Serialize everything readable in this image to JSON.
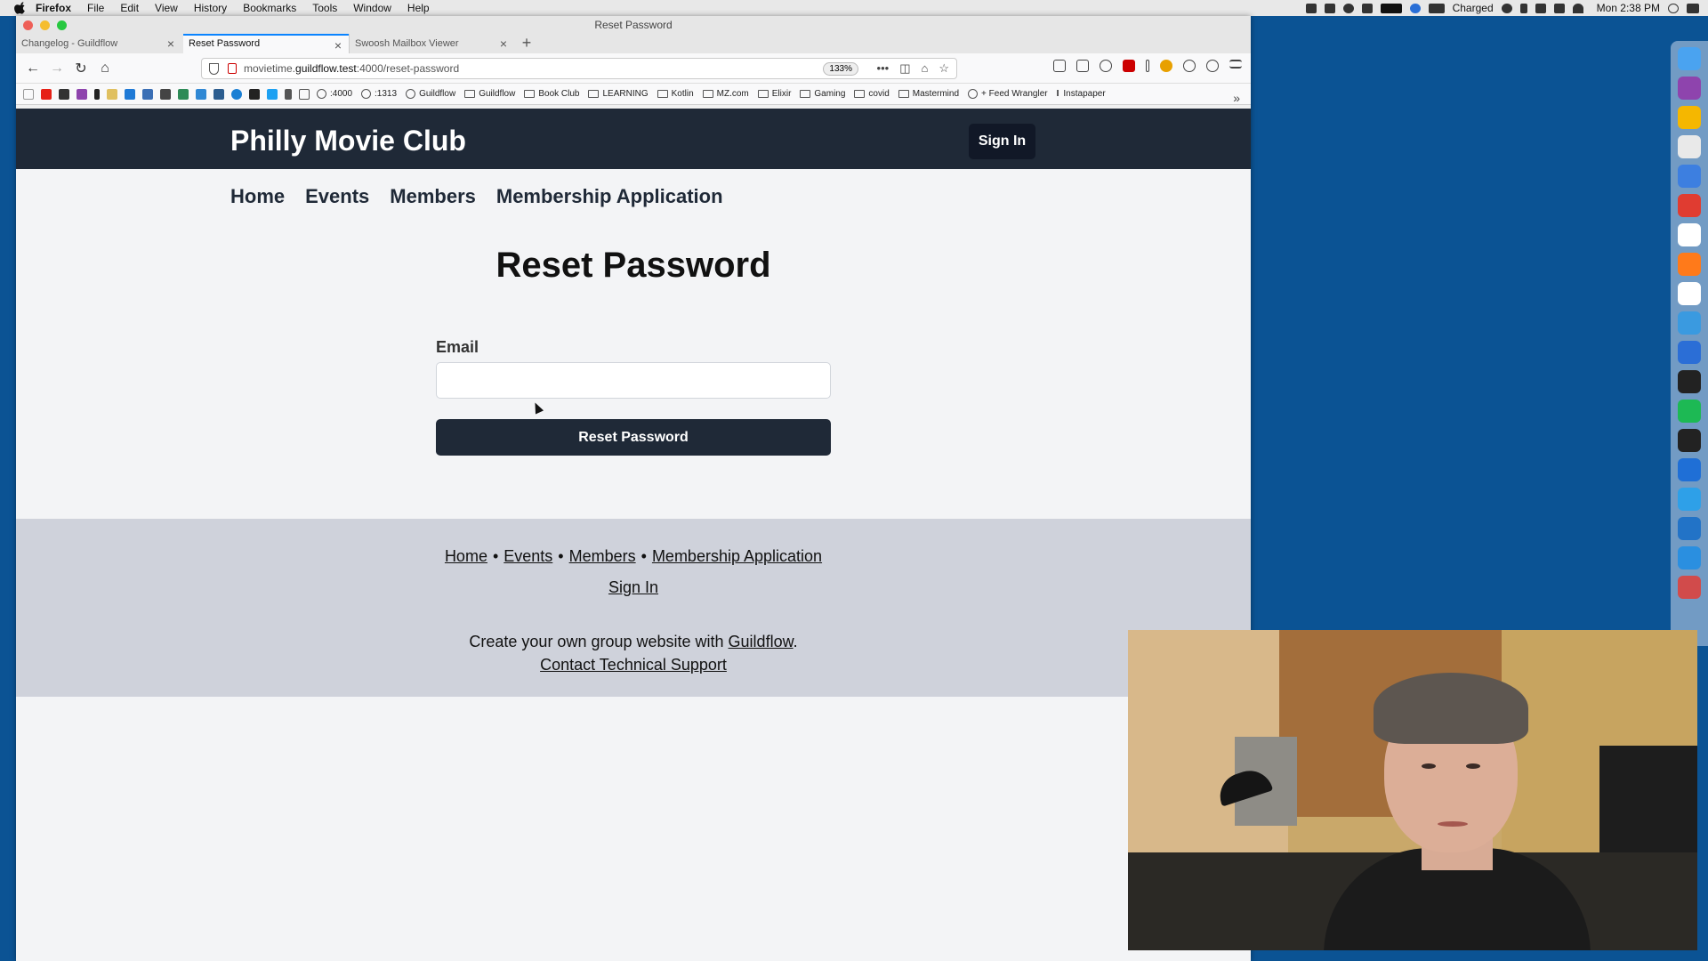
{
  "menubar": {
    "app_name": "Firefox",
    "items": [
      "File",
      "Edit",
      "View",
      "History",
      "Bookmarks",
      "Tools",
      "Window",
      "Help"
    ],
    "battery_text": "Charged",
    "clock": "Mon 2:38 PM"
  },
  "browser": {
    "window_title": "Reset Password",
    "tabs": [
      {
        "title": "Changelog - Guildflow",
        "active": false
      },
      {
        "title": "Reset Password",
        "active": true
      },
      {
        "title": "Swoosh Mailbox Viewer",
        "active": false
      }
    ],
    "url_prefix": "movietime.",
    "url_host": "guildflow.test",
    "url_rest": ":4000/reset-password",
    "zoom": "133%",
    "bookmarks": [
      ":4000",
      ":1313",
      "Guildflow",
      "Guildflow",
      "Book Club",
      "LEARNING",
      "Kotlin",
      "MZ.com",
      "Elixir",
      "Gaming",
      "covid",
      "Mastermind",
      "+ Feed Wrangler",
      "Instapaper"
    ]
  },
  "site": {
    "title": "Philly Movie Club",
    "sign_in_label": "Sign In",
    "nav": [
      "Home",
      "Events",
      "Members",
      "Membership Application"
    ],
    "heading": "Reset Password",
    "email_label": "Email",
    "email_value": "",
    "submit_label": "Reset Password",
    "footer": {
      "links": [
        "Home",
        "Events",
        "Members",
        "Membership Application"
      ],
      "sign_in": "Sign In",
      "create_prefix": "Create your own group website with ",
      "create_link": "Guildflow",
      "create_suffix": ".",
      "support": "Contact Technical Support"
    }
  },
  "dock": {
    "icons": [
      "finder-icon",
      "omnifocus-icon",
      "reeder-icon",
      "slack-icon",
      "ia-writer-icon",
      "todoist-icon",
      "calendar-icon",
      "firefox-icon",
      "readkit-icon",
      "safari-icon",
      "bbedit-icon",
      "bear-icon",
      "spotify-icon",
      "terminal-icon",
      "maps-icon",
      "tweetbot-icon",
      "vscode-icon",
      "xcode-icon",
      "app-icon"
    ],
    "colors": [
      "#4aa3f0",
      "#8e44ad",
      "#f5b700",
      "#e9e9e9",
      "#3d7fe0",
      "#e03c31",
      "#ffffff",
      "#ff7a1a",
      "#ffffff",
      "#3a9ae0",
      "#2b6ed6",
      "#222222",
      "#1db954",
      "#222222",
      "#1f6fd6",
      "#2ea0e8",
      "#2273c7",
      "#2a8fe0",
      "#d14b4b"
    ]
  }
}
